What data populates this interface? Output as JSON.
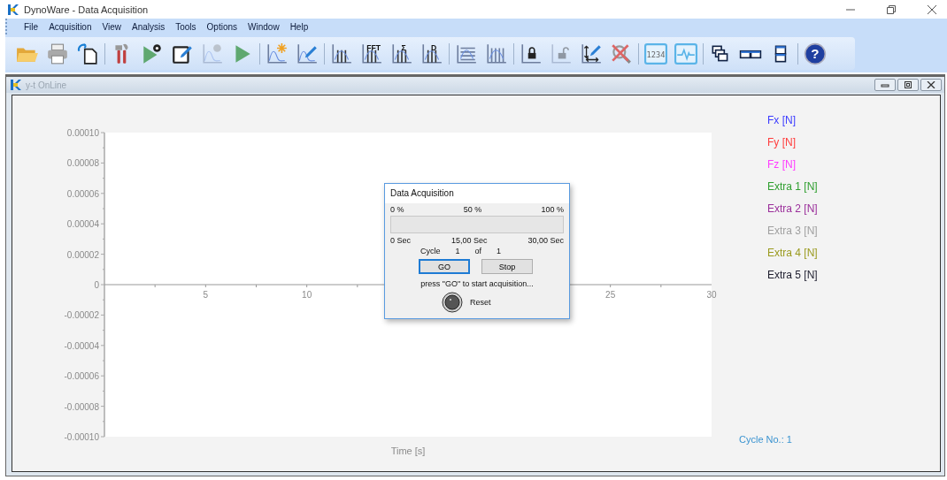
{
  "window": {
    "title": "DynoWare - Data Acquisition"
  },
  "menu": [
    "File",
    "Acquisition",
    "View",
    "Analysis",
    "Tools",
    "Options",
    "Window",
    "Help"
  ],
  "toolbar": [
    [
      {
        "kind": "open",
        "disabled": false
      },
      {
        "kind": "print",
        "disabled": false
      },
      {
        "kind": "export",
        "disabled": false
      }
    ],
    [
      {
        "kind": "tools",
        "disabled": false
      },
      {
        "kind": "run-settings",
        "disabled": false
      },
      {
        "kind": "edit",
        "disabled": false
      },
      {
        "kind": "chart-settings",
        "disabled": true
      },
      {
        "kind": "run",
        "disabled": false
      }
    ],
    [
      {
        "kind": "chart-new",
        "disabled": false
      },
      {
        "kind": "chart-edit",
        "disabled": false
      }
    ],
    [
      {
        "kind": "bars",
        "disabled": false
      },
      {
        "kind": "bars-glyph",
        "glyph": "FFT",
        "disabled": false
      },
      {
        "kind": "bars-glyph",
        "glyph": "Σ",
        "disabled": false
      },
      {
        "kind": "bars-glyph",
        "glyph": "D",
        "disabled": false
      }
    ],
    [
      {
        "kind": "lines",
        "disabled": false
      },
      {
        "kind": "histogram",
        "disabled": false
      }
    ],
    [
      {
        "kind": "axis-lock",
        "disabled": false
      },
      {
        "kind": "axis-unlock",
        "disabled": true
      },
      {
        "kind": "axis-edit",
        "disabled": false
      },
      {
        "kind": "zoom-cancel",
        "disabled": false
      }
    ],
    [
      {
        "kind": "digital",
        "glyph": "1234",
        "disabled": false
      },
      {
        "kind": "scope",
        "disabled": false
      }
    ],
    [
      {
        "kind": "cascade",
        "disabled": false
      },
      {
        "kind": "tile-h",
        "disabled": false
      },
      {
        "kind": "tile-v",
        "disabled": false
      }
    ],
    [
      {
        "kind": "help",
        "glyph": "?",
        "disabled": false
      }
    ]
  ],
  "child_window": {
    "title": "y-t OnLine",
    "chart": {
      "chart_data": {
        "type": "line",
        "xlabel": "Time [s]",
        "xlim": [
          0,
          30
        ],
        "ylim": [
          -0.0001,
          0.0001
        ],
        "xticks": [
          5,
          10,
          25,
          30
        ],
        "yticks": [
          {
            "value": 0.0001,
            "label": "0.00010"
          },
          {
            "value": 8e-05,
            "label": "0.00008"
          },
          {
            "value": 6e-05,
            "label": "0.00006"
          },
          {
            "value": 4e-05,
            "label": "0.00004"
          },
          {
            "value": 2e-05,
            "label": "0.00002"
          },
          {
            "value": 0,
            "label": "0"
          },
          {
            "value": -2e-05,
            "label": "-0.00002"
          },
          {
            "value": -4e-05,
            "label": "-0.00004"
          },
          {
            "value": -6e-05,
            "label": "-0.00006"
          },
          {
            "value": -8e-05,
            "label": "-0.00008"
          },
          {
            "value": -0.0001,
            "label": "-0.00010"
          }
        ]
      }
    },
    "legend": [
      {
        "label": "Fx [N]",
        "color": "#3c3cff"
      },
      {
        "label": "Fy [N]",
        "color": "#ff3c3c"
      },
      {
        "label": "Fz [N]",
        "color": "#ff3cff"
      },
      {
        "label": "Extra 1 [N]",
        "color": "#2e9e2e"
      },
      {
        "label": "Extra 2 [N]",
        "color": "#9a2e9a"
      },
      {
        "label": "Extra 3 [N]",
        "color": "#a0a0a0"
      },
      {
        "label": "Extra 4 [N]",
        "color": "#9a9a1e"
      },
      {
        "label": "Extra 5 [N]",
        "color": "#1e1e2e"
      }
    ],
    "cycle_label": "Cycle No.: 1",
    "dialog": {
      "title": "Data Acquisition",
      "percent_labels": [
        "0 %",
        "50 %",
        "100 %"
      ],
      "progress": {
        "level": 0
      },
      "time_labels": [
        "0 Sec",
        "15,00 Sec",
        "30,00 Sec"
      ],
      "cycle": {
        "label": "Cycle",
        "current": "1",
        "of": "of",
        "total": "1"
      },
      "buttons": [
        {
          "label": "GO",
          "focused": true
        },
        {
          "label": "Stop",
          "focused": false
        }
      ],
      "message": "press \"GO\" to start acquisition...",
      "reset": {
        "label": "Reset"
      }
    }
  }
}
